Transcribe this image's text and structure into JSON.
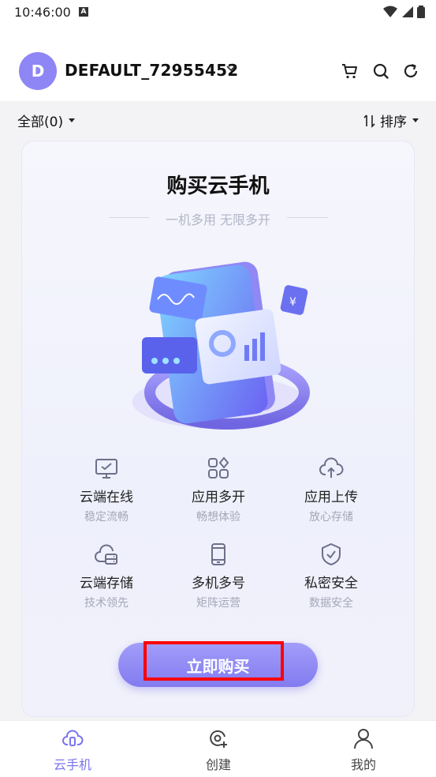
{
  "status": {
    "time": "10:46:00",
    "notif_letter": "A"
  },
  "header": {
    "avatar_letter": "D",
    "account_name": "DEFAULT_72955452"
  },
  "filter": {
    "all_label": "全部(0)",
    "sort_label": "排序"
  },
  "card": {
    "title": "购买云手机",
    "subtitle": "一机多用 无限多开",
    "features": [
      {
        "title": "云端在线",
        "sub": "稳定流畅",
        "icon": "monitor-icon"
      },
      {
        "title": "应用多开",
        "sub": "畅想体验",
        "icon": "apps-grid-icon"
      },
      {
        "title": "应用上传",
        "sub": "放心存储",
        "icon": "cloud-upload-icon"
      },
      {
        "title": "云端存储",
        "sub": "技术领先",
        "icon": "cloud-storage-icon"
      },
      {
        "title": "多机多号",
        "sub": "矩阵运营",
        "icon": "phone-icon"
      },
      {
        "title": "私密安全",
        "sub": "数据安全",
        "icon": "shield-check-icon"
      }
    ],
    "buy_label": "立即购买"
  },
  "tabbar": {
    "tabs": [
      {
        "label": "云手机"
      },
      {
        "label": "创建"
      },
      {
        "label": "我的"
      }
    ]
  },
  "colors": {
    "accent": "#7a74ee",
    "icon_stroke": "#6d6f8a",
    "highlight": "#ff0000"
  }
}
